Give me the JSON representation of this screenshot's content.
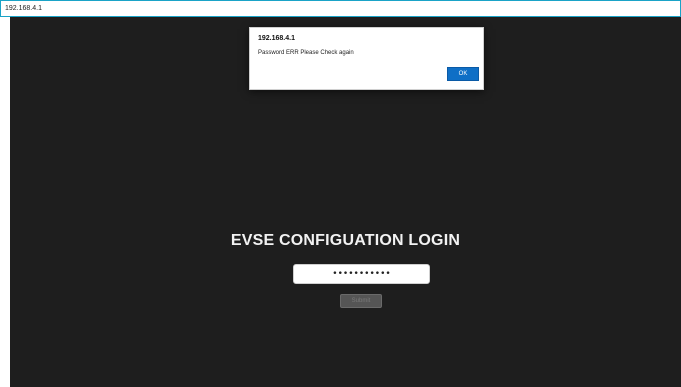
{
  "browser": {
    "address": "192.168.4.1"
  },
  "alert": {
    "title": "192.168.4.1",
    "message": "Password ERR Please Check again",
    "ok_label": "OK"
  },
  "login": {
    "title": "EVSE CONFIGUATION LOGIN",
    "password_value": "•••••••••••",
    "submit_label": "Submit"
  },
  "colors": {
    "page_background": "#1e1e1e",
    "accent": "#0f6fc6",
    "address_border": "#1aa3c7"
  }
}
